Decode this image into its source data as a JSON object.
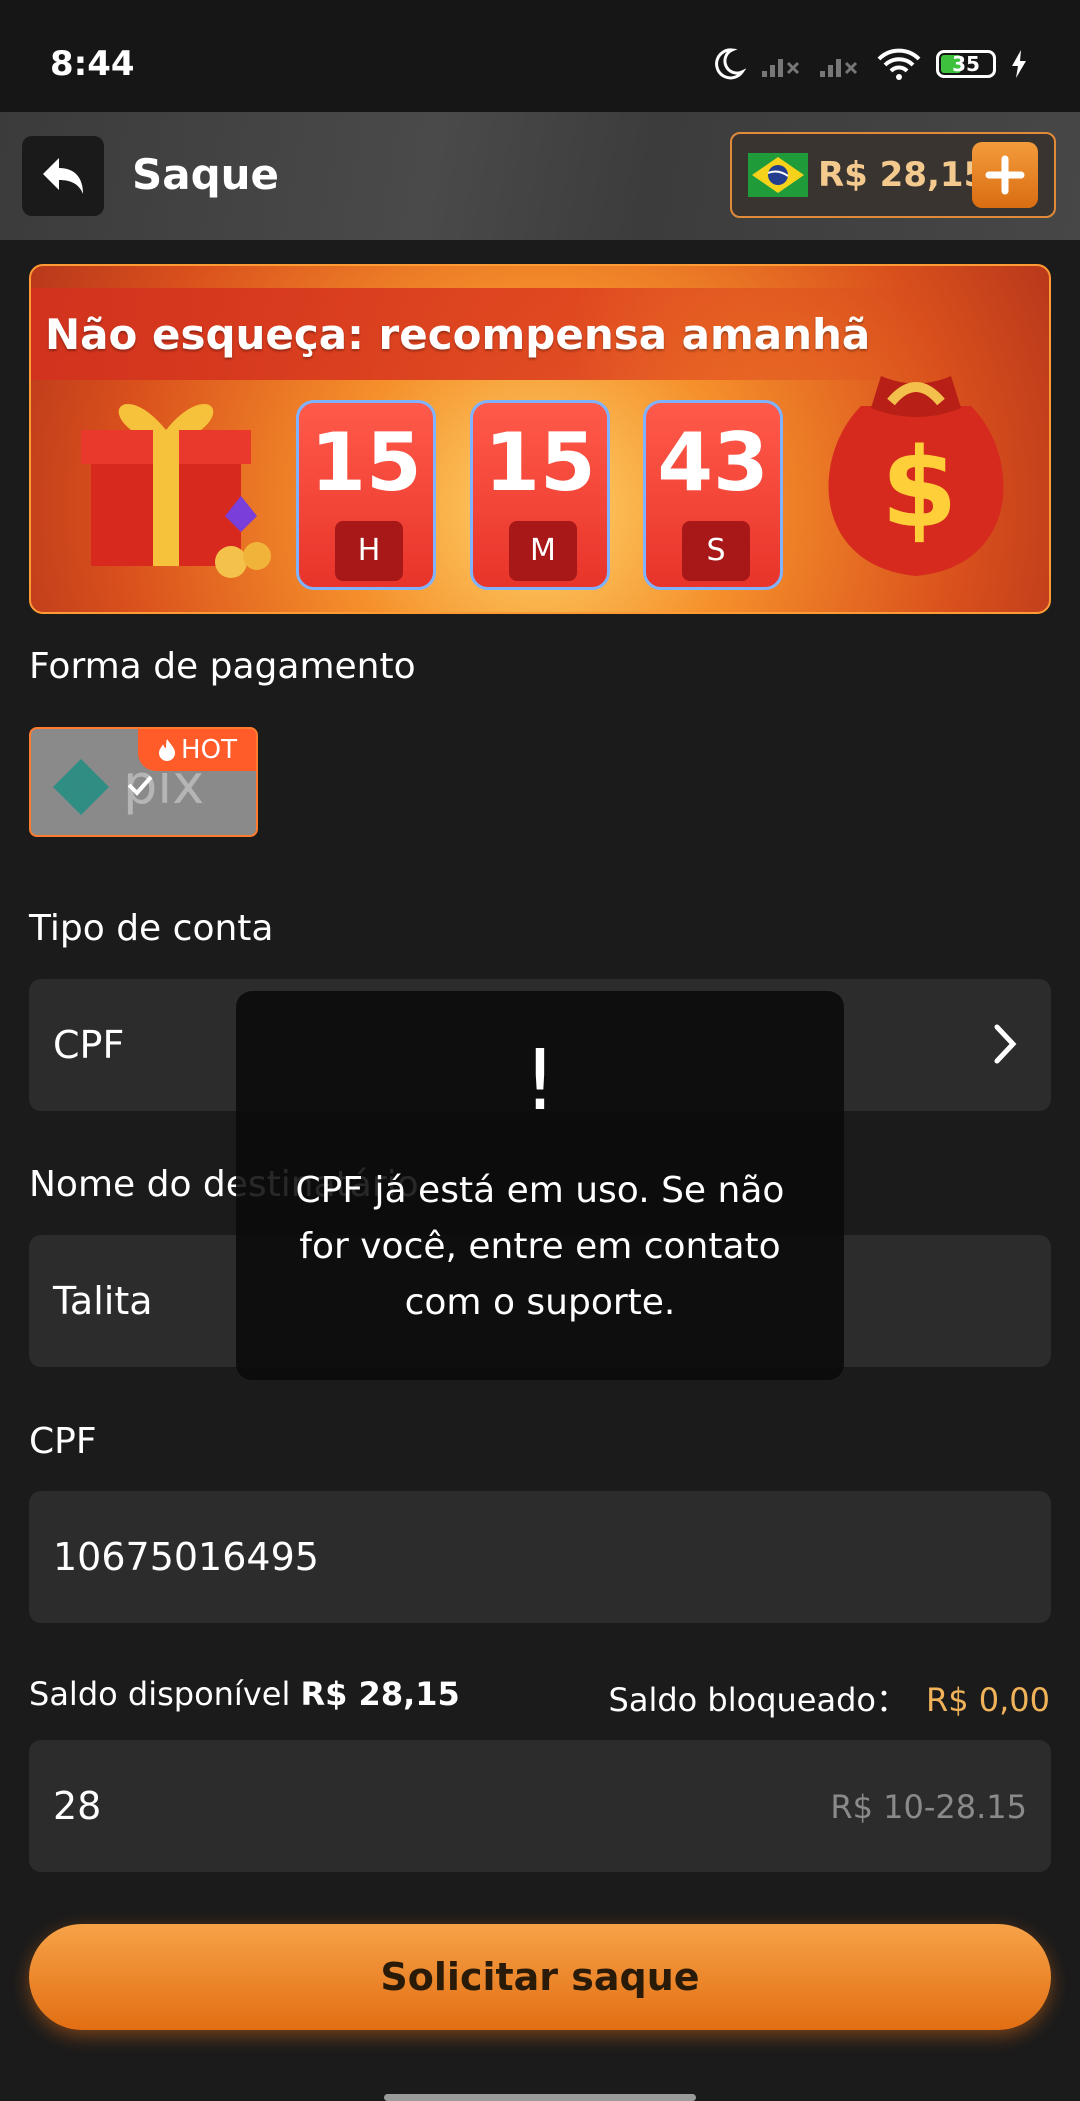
{
  "status_bar": {
    "time": "8:44",
    "battery": "35"
  },
  "header": {
    "title": "Saque",
    "balance": "R$ 28,15"
  },
  "banner": {
    "title": "Não esqueça: recompensa amanhã",
    "timer": [
      {
        "value": "15",
        "unit": "H"
      },
      {
        "value": "15",
        "unit": "M"
      },
      {
        "value": "43",
        "unit": "S"
      }
    ]
  },
  "payment": {
    "label": "Forma de pagamento",
    "method": "pix",
    "hot_badge": "HOT"
  },
  "account_type": {
    "label": "Tipo de conta",
    "value": "CPF"
  },
  "beneficiary": {
    "label": "Nome do destinatário",
    "value": "Talita"
  },
  "cpf": {
    "label": "CPF",
    "value": "10675016495"
  },
  "balance_info": {
    "available_label": "Saldo disponível",
    "available_value": "R$ 28,15",
    "blocked_label": "Saldo bloqueado：",
    "blocked_value": "R$ 0,00"
  },
  "amount": {
    "value": "28",
    "range_hint": "R$ 10-28.15"
  },
  "submit_label": "Solicitar saque",
  "toast": {
    "icon": "!",
    "message": "CPF já está em uso. Se não for você, entre em contato com o suporte."
  }
}
